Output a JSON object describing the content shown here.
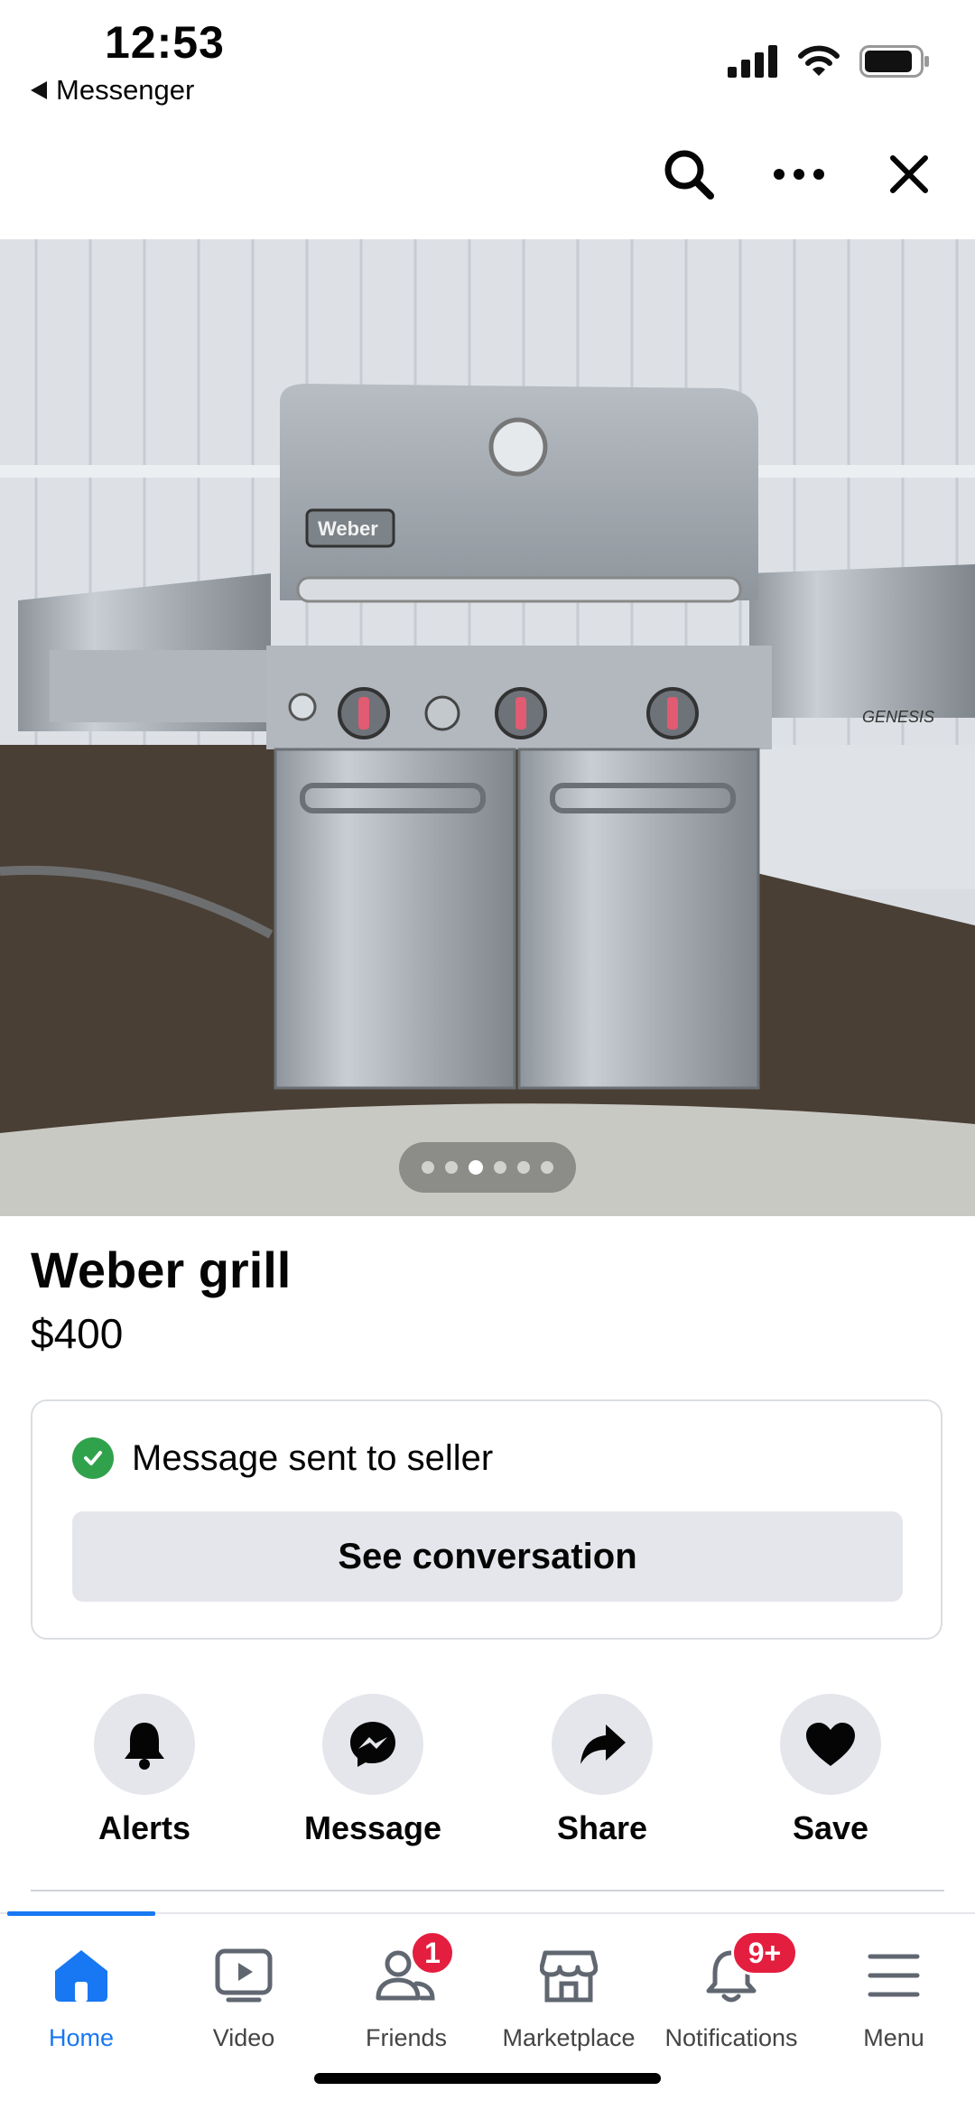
{
  "status": {
    "time": "12:53",
    "back_app": "Messenger"
  },
  "toolbar": {
    "icons": [
      "search-icon",
      "more-icon",
      "close-icon"
    ]
  },
  "listing": {
    "photo_alt": "Weber grill photo",
    "photo_count": 6,
    "photo_active_index": 2,
    "title": "Weber grill",
    "price": "$400"
  },
  "message_card": {
    "status": "Message sent to seller",
    "button": "See conversation"
  },
  "actions": [
    {
      "label": "Alerts",
      "icon": "bell-icon"
    },
    {
      "label": "Message",
      "icon": "messenger-icon"
    },
    {
      "label": "Share",
      "icon": "share-icon"
    },
    {
      "label": "Save",
      "icon": "heart-icon"
    }
  ],
  "nav": {
    "items": [
      {
        "label": "Home",
        "icon": "home-icon",
        "active": true
      },
      {
        "label": "Video",
        "icon": "video-icon"
      },
      {
        "label": "Friends",
        "icon": "friends-icon",
        "badge": "1"
      },
      {
        "label": "Marketplace",
        "icon": "marketplace-icon"
      },
      {
        "label": "Notifications",
        "icon": "notifications-icon",
        "badge": "9+"
      },
      {
        "label": "Menu",
        "icon": "menu-icon"
      }
    ]
  },
  "colors": {
    "accent": "#1877f2",
    "badge": "#e41e3f",
    "success": "#31a24c",
    "button_bg": "#e4e6eb"
  }
}
